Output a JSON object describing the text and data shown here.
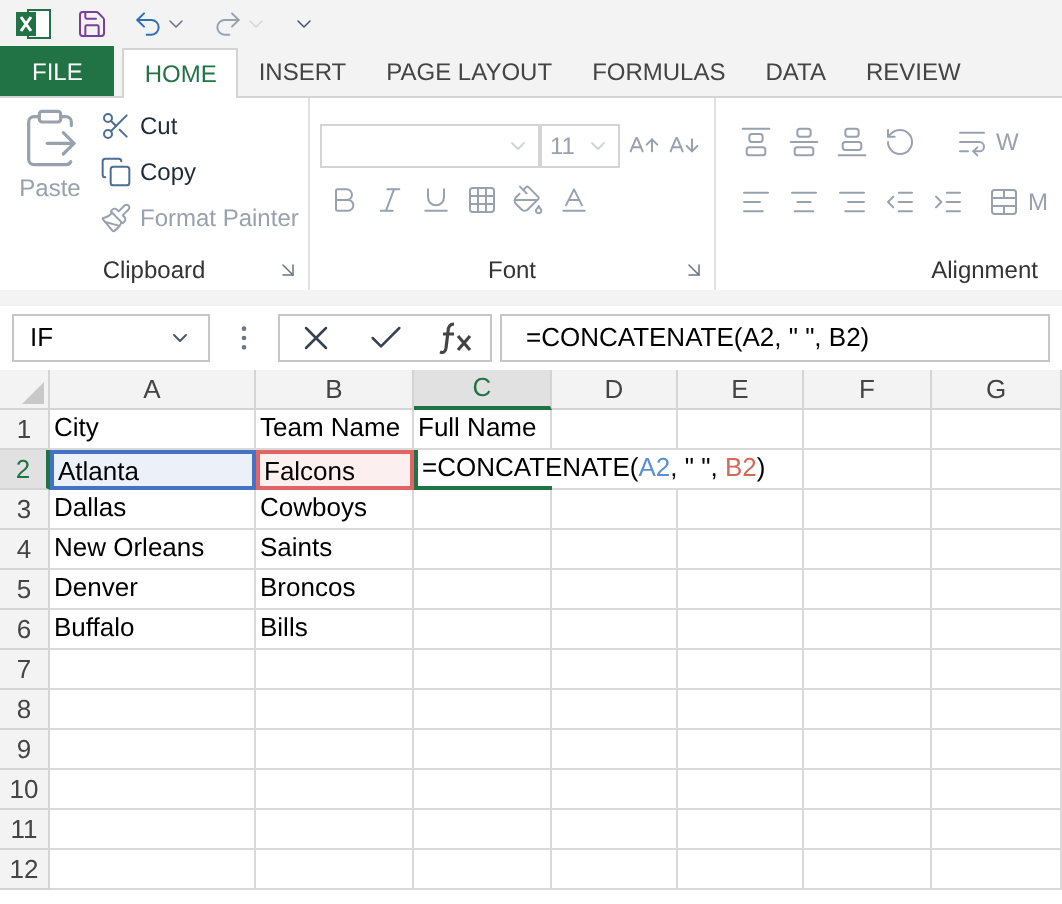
{
  "ribbon_tabs": [
    {
      "label": "FILE",
      "kind": "file",
      "selected": false
    },
    {
      "label": "HOME",
      "kind": "tab",
      "selected": true
    },
    {
      "label": "INSERT",
      "kind": "tab",
      "selected": false
    },
    {
      "label": "PAGE LAYOUT",
      "kind": "tab",
      "selected": false
    },
    {
      "label": "FORMULAS",
      "kind": "tab",
      "selected": false
    },
    {
      "label": "DATA",
      "kind": "tab",
      "selected": false
    },
    {
      "label": "REVIEW",
      "kind": "tab",
      "selected": false
    }
  ],
  "clipboard": {
    "label": "Clipboard",
    "paste": {
      "label": "Paste",
      "disabled": true
    },
    "items": [
      {
        "label": "Cut",
        "disabled": false
      },
      {
        "label": "Copy",
        "disabled": false
      },
      {
        "label": "Format Painter",
        "disabled": true
      }
    ]
  },
  "font": {
    "label": "Font",
    "size": "11"
  },
  "alignment": {
    "label": "Alignment",
    "wrap_label": "W",
    "merge_label": "M"
  },
  "formula_bar": {
    "name_box": "IF",
    "formula": "=CONCATENATE(A2, \" \", B2)"
  },
  "sheet": {
    "columns": [
      {
        "label": "A",
        "selected": false
      },
      {
        "label": "B",
        "selected": false
      },
      {
        "label": "C",
        "selected": true
      },
      {
        "label": "D",
        "selected": false
      },
      {
        "label": "E",
        "selected": false
      },
      {
        "label": "F",
        "selected": false
      },
      {
        "label": "G",
        "selected": false
      }
    ],
    "rows": [
      {
        "header": "1",
        "selected": false,
        "cells": [
          {
            "text": "City"
          },
          {
            "text": "Team Name"
          },
          {
            "text": "Full Name"
          }
        ]
      },
      {
        "header": "2",
        "selected": true,
        "cells": [
          {
            "text": "Atlanta",
            "color": "#4472c4"
          },
          {
            "text": "Falcons",
            "color": "#e06666"
          },
          {
            "parts": [
              {
                "text": "=CONCATENATE(",
                "color": "#000000"
              },
              {
                "text": "A2",
                "color": "#5b8fd0"
              },
              {
                "text": ", \" \", ",
                "color": "#000000"
              },
              {
                "text": "B2",
                "color": "#d06a5a"
              },
              {
                "text": ")",
                "color": "#000000"
              }
            ]
          }
        ]
      },
      {
        "header": "3",
        "selected": false,
        "cells": [
          {
            "text": "Dallas"
          },
          {
            "text": "Cowboys"
          }
        ]
      },
      {
        "header": "4",
        "selected": false,
        "cells": [
          {
            "text": "New Orleans"
          },
          {
            "text": "Saints"
          }
        ]
      },
      {
        "header": "5",
        "selected": false,
        "cells": [
          {
            "text": "Denver"
          },
          {
            "text": "Broncos"
          }
        ]
      },
      {
        "header": "6",
        "selected": false,
        "cells": [
          {
            "text": "Buffalo"
          },
          {
            "text": "Bills"
          }
        ]
      },
      {
        "header": "7",
        "selected": false,
        "cells": []
      },
      {
        "header": "8",
        "selected": false,
        "cells": []
      },
      {
        "header": "9",
        "selected": false,
        "cells": []
      },
      {
        "header": "10",
        "selected": false,
        "cells": []
      },
      {
        "header": "11",
        "selected": false,
        "cells": []
      },
      {
        "header": "12",
        "selected": false,
        "cells": []
      }
    ]
  }
}
